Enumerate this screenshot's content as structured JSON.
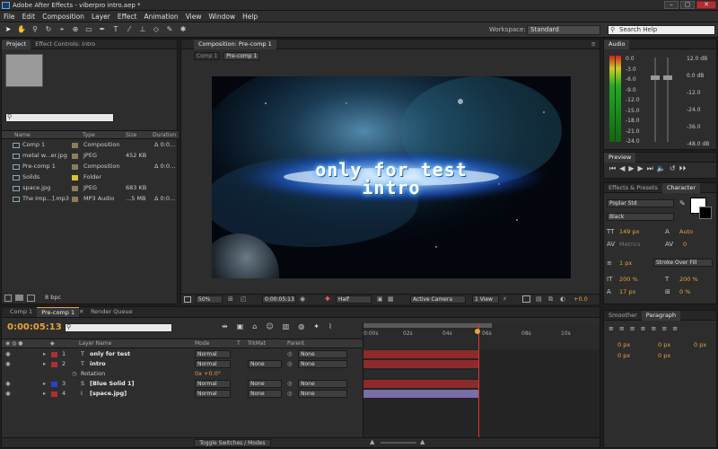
{
  "window": {
    "title": "Adobe After Effects - viberpro intro.aep *"
  },
  "menu": [
    "File",
    "Edit",
    "Composition",
    "Layer",
    "Effect",
    "Animation",
    "View",
    "Window",
    "Help"
  ],
  "toolbar": {
    "workspace_label": "Workspace:",
    "workspace_value": "Standard",
    "search_placeholder": "Search Help"
  },
  "project": {
    "tabs": [
      "Project",
      "Effect Controls: intro"
    ],
    "search_placeholder": "",
    "columns": [
      "Name",
      "Type",
      "Size",
      "Duration"
    ],
    "items": [
      {
        "name": "Comp 1",
        "type": "Composition",
        "size": "",
        "duration": "Δ 0:0…",
        "color": "#8b7d5a"
      },
      {
        "name": "metal w...er.jpg",
        "type": "JPEG",
        "size": "452 KB",
        "duration": "",
        "color": "#8b7d5a"
      },
      {
        "name": "Pre-comp 1",
        "type": "Composition",
        "size": "",
        "duration": "Δ 0:0…",
        "color": "#8b7d5a"
      },
      {
        "name": "Solids",
        "type": "Folder",
        "size": "",
        "duration": "",
        "color": "#d6c23a"
      },
      {
        "name": "space.jpg",
        "type": "JPEG",
        "size": "683 KB",
        "duration": "",
        "color": "#8b7d5a"
      },
      {
        "name": "The Imp...].mp3",
        "type": "MP3 Audio",
        "size": "...5 MB",
        "duration": "Δ 0:0…",
        "color": "#8b7d5a"
      }
    ],
    "bpc": "8 bpc"
  },
  "composition": {
    "tab": "Composition: Pre-comp 1",
    "breadcrumbs": [
      "Comp 1",
      "Pre-comp 1"
    ],
    "title_line1": "only for test",
    "title_line2": "intro",
    "zoom": "50%",
    "timecode": "0:00:05:13",
    "resolution": "Half",
    "camera": "Active Camera",
    "views": "1 View",
    "exposure": "+0.0"
  },
  "audio": {
    "tab": "Audio",
    "left_scale": [
      "0.0",
      "-3.0",
      "-6.0",
      "-9.0",
      "-12.0",
      "-15.0",
      "-18.0",
      "-21.0",
      "-24.0"
    ],
    "right_scale": [
      "12.0 dB",
      "0.0 dB",
      "-12.0",
      "-24.0",
      "-36.0",
      "-48.0 dB"
    ]
  },
  "preview": {
    "tab": "Preview"
  },
  "character": {
    "tabs": [
      "Effects & Presets",
      "Character"
    ],
    "font": "Poplar Std",
    "style": "Black",
    "font_size": "149 px",
    "leading": "Auto",
    "kerning": "Metrics",
    "tracking": "0",
    "stroke_width": "1 px",
    "stroke_mode": "Stroke Over Fill",
    "vscale": "200 %",
    "hscale": "200 %",
    "baseline": "17 px",
    "tsume": "0 %"
  },
  "paragraph": {
    "tabs": [
      "Smoother",
      "Paragraph"
    ],
    "values": [
      "0 px",
      "0 px",
      "0 px",
      "0 px",
      "0 px"
    ]
  },
  "timeline": {
    "tabs": [
      "Comp 1",
      "Pre-comp 1",
      "Render Queue"
    ],
    "timecode": "0:00:05:13",
    "columns": {
      "layer_name": "Layer Name",
      "mode": "Mode",
      "t": "T",
      "trkmat": "TrkMat",
      "parent": "Parent"
    },
    "ruler": [
      "0:00s",
      "02s",
      "04s",
      "06s",
      "08s",
      "10s"
    ],
    "layers": [
      {
        "num": "1",
        "name": "only for test",
        "mode": "Normal",
        "trkmat": "",
        "parent": "None",
        "label": "#b03030",
        "kind": "T"
      },
      {
        "num": "2",
        "name": "intro",
        "mode": "Normal",
        "trkmat": "None",
        "parent": "None",
        "label": "#b03030",
        "kind": "T"
      },
      {
        "num": "3",
        "name": "[Blue Solid 1]",
        "mode": "Normal",
        "trkmat": "None",
        "parent": "None",
        "label": "#2a3fd6",
        "kind": "S"
      },
      {
        "num": "4",
        "name": "[space.jpg]",
        "mode": "Normal",
        "trkmat": "None",
        "parent": "None",
        "label": "#b03030",
        "kind": "I"
      }
    ],
    "rotation_label": "Rotation",
    "rotation_value": "0x +0.0°",
    "toggle_label": "Toggle Switches / Modes"
  }
}
